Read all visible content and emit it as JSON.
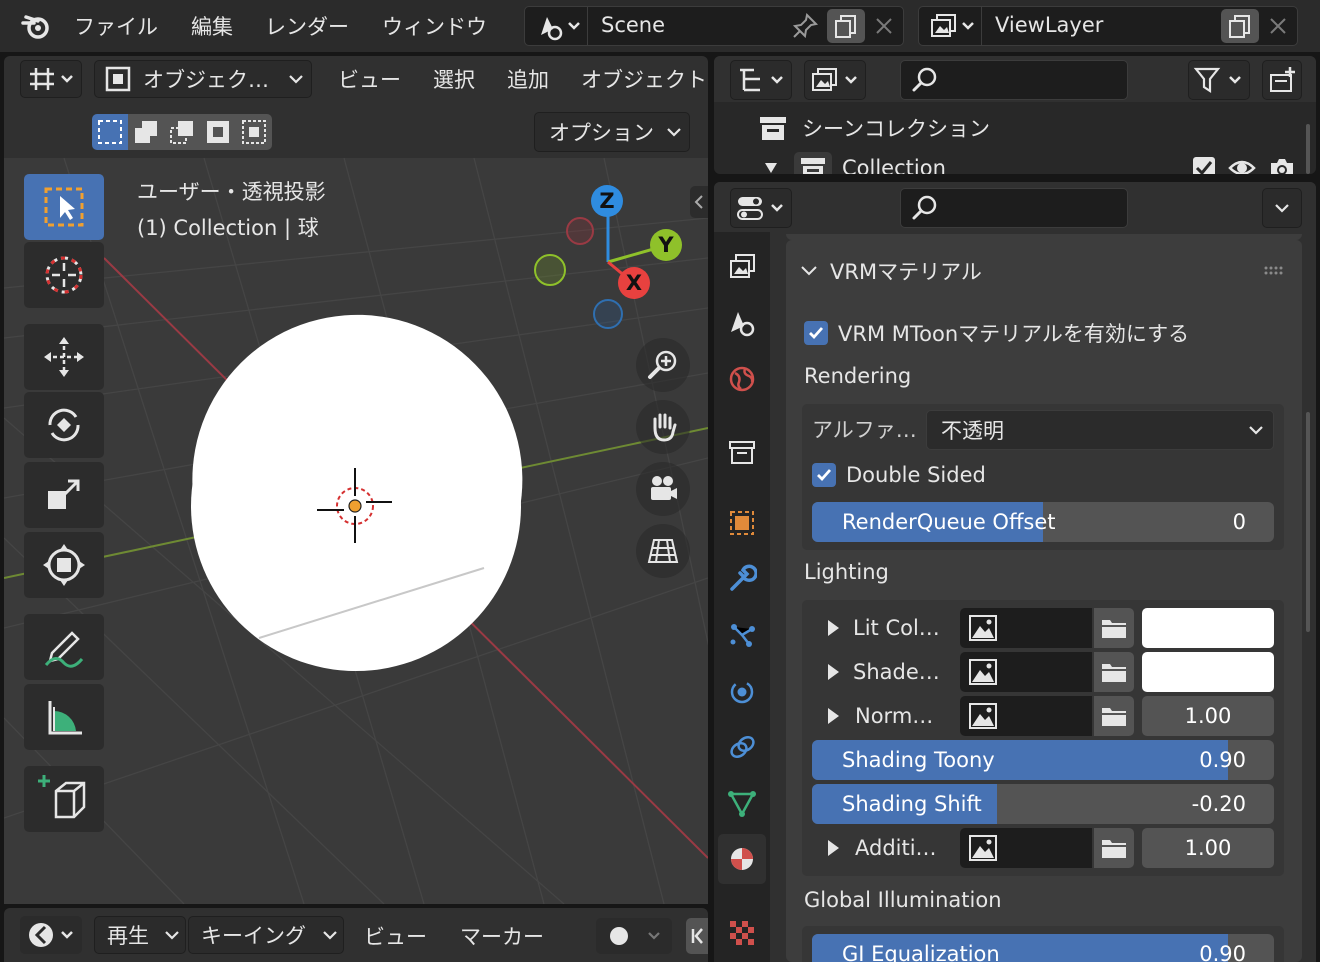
{
  "topbar": {
    "menus": [
      "ファイル",
      "編集",
      "レンダー",
      "ウィンドウ"
    ],
    "scene": "Scene",
    "view_layer": "ViewLayer"
  },
  "viewport": {
    "mode": "オブジェク…",
    "menus": [
      "ビュー",
      "選択",
      "追加",
      "オブジェクト"
    ],
    "options": "オプション",
    "view_name": "ユーザー・透視投影",
    "collection_info": "(1) Collection | 球",
    "gizmo": {
      "x": "X",
      "y": "Y",
      "z": "Z"
    }
  },
  "timeline": {
    "menus": [
      "再生",
      "キーイング",
      "ビュー",
      "マーカー"
    ]
  },
  "outliner": {
    "scene_collection": "シーンコレクション",
    "collection": "Collection"
  },
  "properties": {
    "panel_title": "VRMマテリアル",
    "enable_mtoon": "VRM MToonマテリアルを有効にする",
    "rendering": {
      "title": "Rendering",
      "alpha_label": "アルファ…",
      "alpha_value": "不透明",
      "double_sided": "Double Sided",
      "render_queue_label": "RenderQueue Offset",
      "render_queue_value": "0",
      "render_queue_fill": 0.5
    },
    "lighting": {
      "title": "Lighting",
      "lit_color": "Lit Col…",
      "shade_color": "Shade…",
      "normal": "Norm…",
      "normal_value": "1.00",
      "shading_toony_label": "Shading Toony",
      "shading_toony_value": "0.90",
      "shading_toony_fill": 0.9,
      "shading_shift_label": "Shading Shift",
      "shading_shift_value": "-0.20",
      "shading_shift_fill": 0.4,
      "additive": "Additi…",
      "additive_value": "1.00"
    },
    "gi": {
      "title": "Global Illumination",
      "gi_eq_label": "GI Equalization",
      "gi_eq_value": "0.90",
      "gi_eq_fill": 0.9
    }
  },
  "colors": {
    "accent": "#4772b3",
    "x_axis": "#e8413f",
    "y_axis": "#8fc12a",
    "z_axis": "#2f8ce0"
  }
}
